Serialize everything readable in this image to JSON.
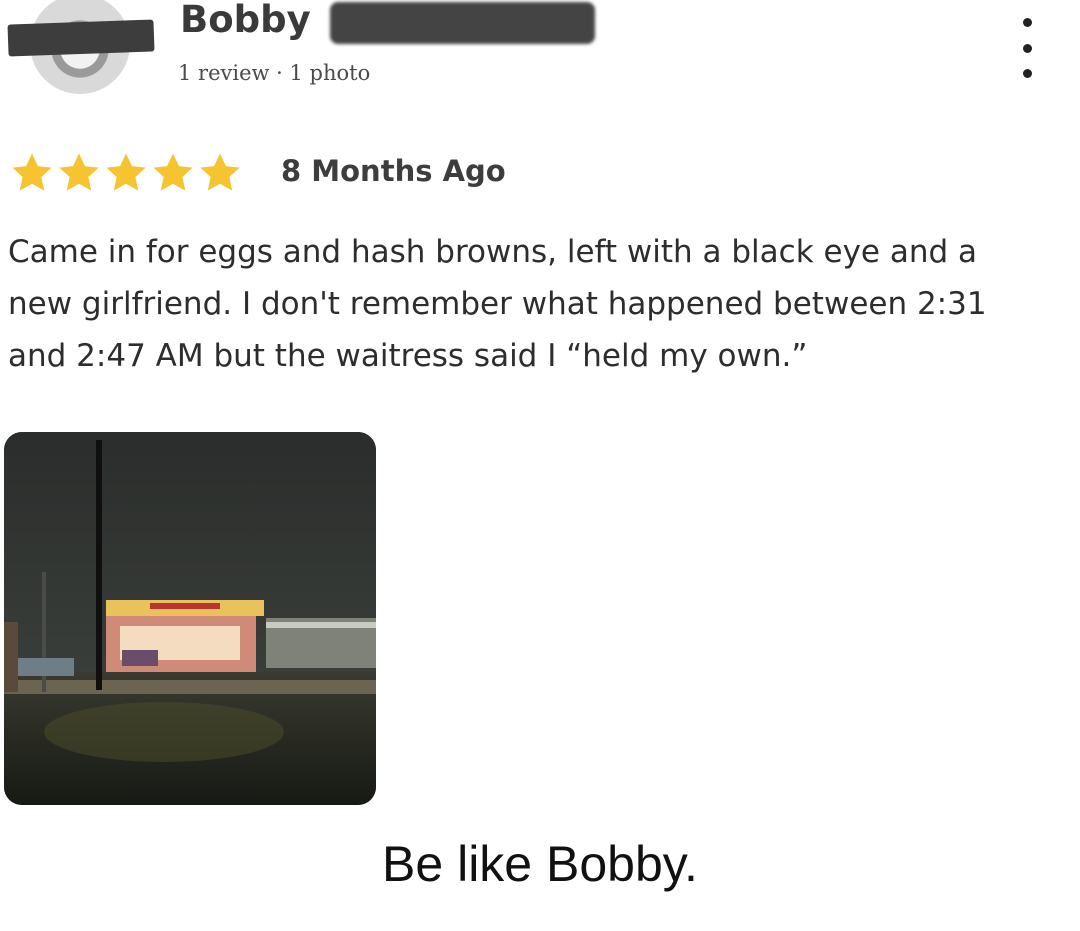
{
  "review": {
    "author": {
      "name": "Bobby",
      "meta": "1 review · 1 photo"
    },
    "rating": 5,
    "time_ago": "8 Months Ago",
    "text": "Came in for eggs and hash browns, left with a black eye and a\nnew girlfriend. I don't remember what happened between 2:31\nand 2:47 AM but the waitress said I “held my own.”",
    "photo": {
      "icon": "restaurant-night-photo"
    },
    "menu_icon": "more-vert-icon"
  },
  "caption": "Be like Bobby.",
  "colors": {
    "star": "#f6c431",
    "text": "#2d2d2d"
  }
}
